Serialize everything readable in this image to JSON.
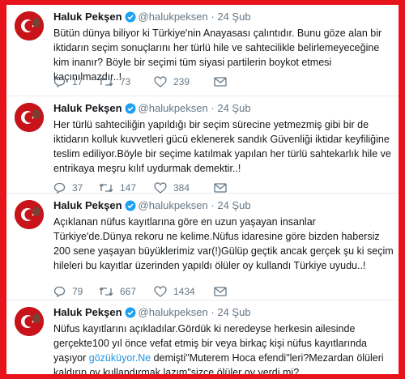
{
  "tweets": [
    {
      "name": "Haluk Pekşen",
      "handle": "@halukpeksen",
      "sep": "·",
      "date": "24 Şub",
      "text": "Bütün dünya biliyor ki Türkiye'nin Anayasası çalıntıdır. Bunu göze alan bir iktidarın seçim sonuçlarını her türlü hile ve sahtecilikle belirlemeyeceğine kim inanır? Böyle bir seçimi tüm siyasi partilerin boykot etmesi kaçınılmazdır..!",
      "replies": "17",
      "retweets": "73",
      "likes": "239"
    },
    {
      "name": "Haluk Pekşen",
      "handle": "@halukpeksen",
      "sep": "·",
      "date": "24 Şub",
      "text": "Her türlü sahteciliğin yapıldığı bir seçim sürecine yetmezmiş gibi bir de iktidarın kolluk kuvvetleri gücü eklenerek sandık Güvenliği iktidar keyfiliğine teslim ediliyor.Böyle bir seçime katılmak yapılan her türlü sahtekarlık hile ve entrikaya meşru kılıf uydurmak demektir..!",
      "replies": "37",
      "retweets": "147",
      "likes": "384"
    },
    {
      "name": "Haluk Pekşen",
      "handle": "@halukpeksen",
      "sep": "·",
      "date": "24 Şub",
      "text": "Açıklanan nüfus kayıtlarına göre en uzun yaşayan insanlar Türkiye'de.Dünya rekoru ne kelime.Nüfus idaresine göre bizden habersiz 200 sene yaşayan büyüklerimiz var(!)Gülüp geçtik ancak gerçek şu ki seçim hileleri bu kayıtlar üzerinden yapıldı ölüler oy kullandı Türkiye uyudu..!",
      "replies": "79",
      "retweets": "667",
      "likes": "1434"
    },
    {
      "name": "Haluk Pekşen",
      "handle": "@halukpeksen",
      "sep": "·",
      "date": "24 Şub",
      "text_before": "Nüfus kayıtlarını açıkladılar.Gördük ki neredeyse herkesin ailesinde gerçekte100 yıl önce vefat etmiş bir veya birkaç kişi nüfus kayıtlarında yaşıyor ",
      "link": "gözüküyor.Ne",
      "text_after": " demişti\"Muterem Hoca efendi\"leri?Mezardan ölüleri kaldırıp oy kullandırmak lazım\"sizce ölüler oy verdi mi?"
    }
  ],
  "colors": {
    "background_frame": "#e8141c",
    "verified": "#1da1f2",
    "link": "#1b95e0",
    "text": "#14171a",
    "muted": "#657786"
  },
  "icons": {
    "verified": "verified-badge-icon",
    "reply": "reply-icon",
    "retweet": "retweet-icon",
    "like": "heart-icon",
    "message": "envelope-icon",
    "caret": "chevron-down-icon"
  }
}
